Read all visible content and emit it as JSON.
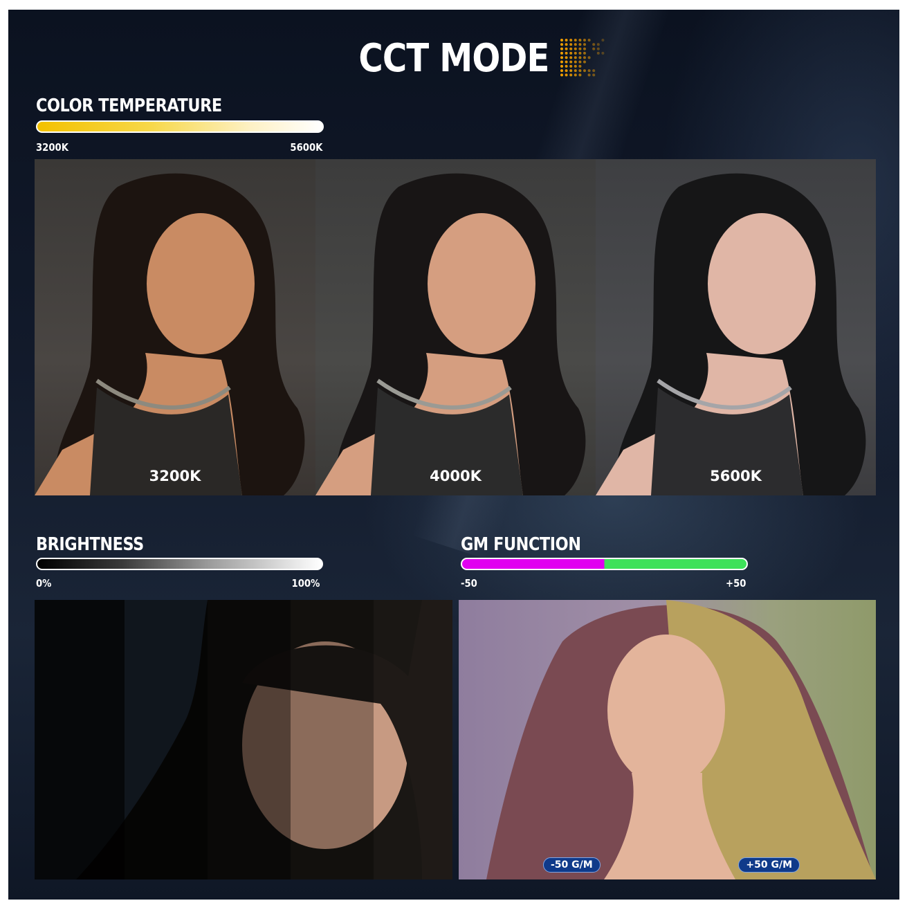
{
  "title": "CCT MODE",
  "color_temperature": {
    "label": "COLOR TEMPERATURE",
    "min": "3200K",
    "max": "5600K",
    "photos": [
      "3200K",
      "4000K",
      "5600K"
    ]
  },
  "brightness": {
    "label": "BRIGHTNESS",
    "min": "0%",
    "max": "100%"
  },
  "gm_function": {
    "label": "GM FUNCTION",
    "min": "-50",
    "max": "+50",
    "badges": [
      "-50 G/M",
      "+50 G/M"
    ]
  },
  "colors": {
    "background": "#121a2b",
    "temp_warm": "#f3c100",
    "magenta": "#e100f0",
    "green": "#3ee15a",
    "badge": "#0f3a8a"
  }
}
